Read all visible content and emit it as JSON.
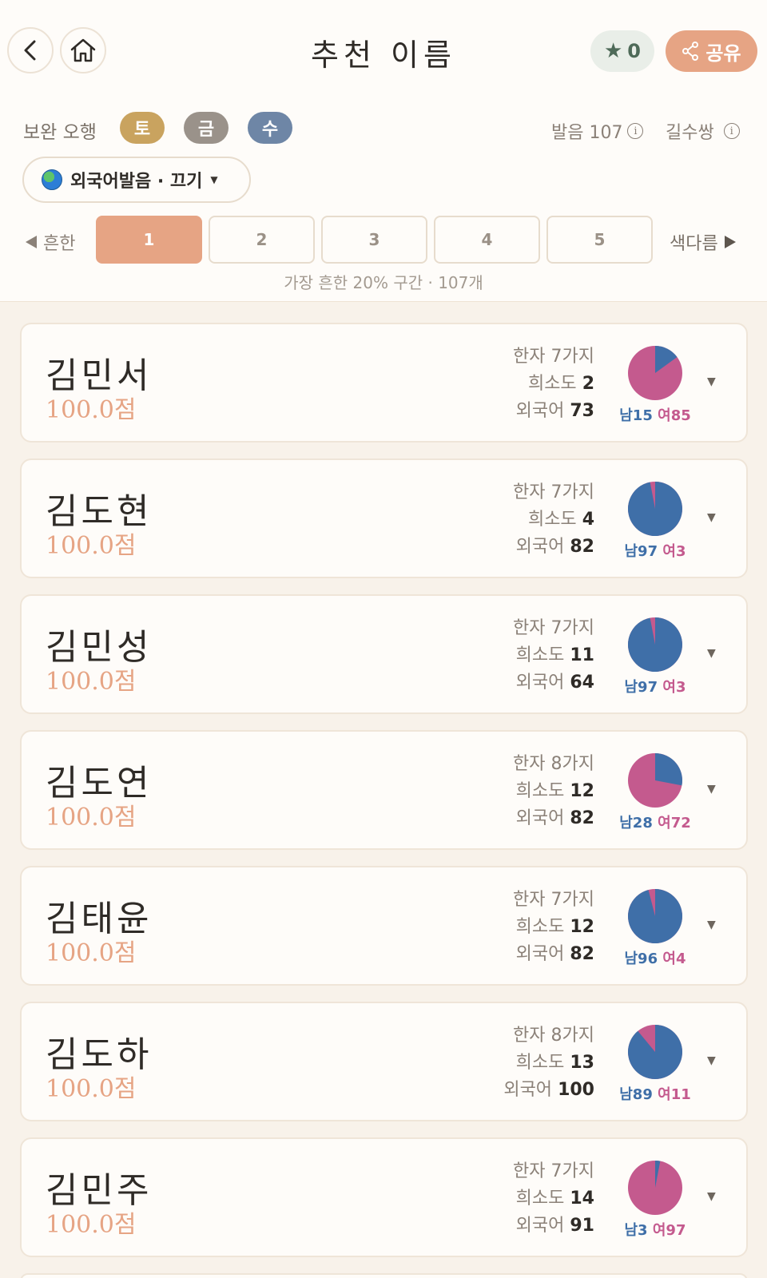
{
  "header": {
    "title": "추천 이름",
    "favorites_count": "0",
    "share_label": "공유"
  },
  "supplement": {
    "label": "보완 오행",
    "elements": [
      {
        "label": "토",
        "color": "#c9a35f"
      },
      {
        "label": "금",
        "color": "#9a928a"
      },
      {
        "label": "수",
        "color": "#6e86a6"
      }
    ]
  },
  "meta": {
    "pronunciation": "발음 107",
    "gilsu": "길수쌍"
  },
  "filter": {
    "label": "외국어발음 · 끄기"
  },
  "pagination": {
    "left_label": "흔한",
    "right_label": "색다름",
    "pages": [
      "1",
      "2",
      "3",
      "4",
      "5"
    ],
    "active_page": "1",
    "caption": "가장 흔한 20% 구간 · 107개"
  },
  "names": [
    {
      "name": "김민서",
      "score": "100.0점",
      "hanja": "한자 7가지",
      "rarity_label": "희소도",
      "rarity": "2",
      "foreign_label": "외국어",
      "foreign": "73",
      "male_label": "남15",
      "female_label": "여85",
      "male_pct": 15
    },
    {
      "name": "김도현",
      "score": "100.0점",
      "hanja": "한자 7가지",
      "rarity_label": "희소도",
      "rarity": "4",
      "foreign_label": "외국어",
      "foreign": "82",
      "male_label": "남97",
      "female_label": "여3",
      "male_pct": 97
    },
    {
      "name": "김민성",
      "score": "100.0점",
      "hanja": "한자 7가지",
      "rarity_label": "희소도",
      "rarity": "11",
      "foreign_label": "외국어",
      "foreign": "64",
      "male_label": "남97",
      "female_label": "여3",
      "male_pct": 97
    },
    {
      "name": "김도연",
      "score": "100.0점",
      "hanja": "한자 8가지",
      "rarity_label": "희소도",
      "rarity": "12",
      "foreign_label": "외국어",
      "foreign": "82",
      "male_label": "남28",
      "female_label": "여72",
      "male_pct": 28
    },
    {
      "name": "김태윤",
      "score": "100.0점",
      "hanja": "한자 7가지",
      "rarity_label": "희소도",
      "rarity": "12",
      "foreign_label": "외국어",
      "foreign": "82",
      "male_label": "남96",
      "female_label": "여4",
      "male_pct": 96
    },
    {
      "name": "김도하",
      "score": "100.0점",
      "hanja": "한자 8가지",
      "rarity_label": "희소도",
      "rarity": "13",
      "foreign_label": "외국어",
      "foreign": "100",
      "male_label": "남89",
      "female_label": "여11",
      "male_pct": 89
    },
    {
      "name": "김민주",
      "score": "100.0점",
      "hanja": "한자 7가지",
      "rarity_label": "희소도",
      "rarity": "14",
      "foreign_label": "외국어",
      "foreign": "91",
      "male_label": "남3",
      "female_label": "여97",
      "male_pct": 3
    }
  ],
  "colors": {
    "accent": "#e6a484",
    "male": "#3f6fa8",
    "female": "#c45a8e"
  }
}
